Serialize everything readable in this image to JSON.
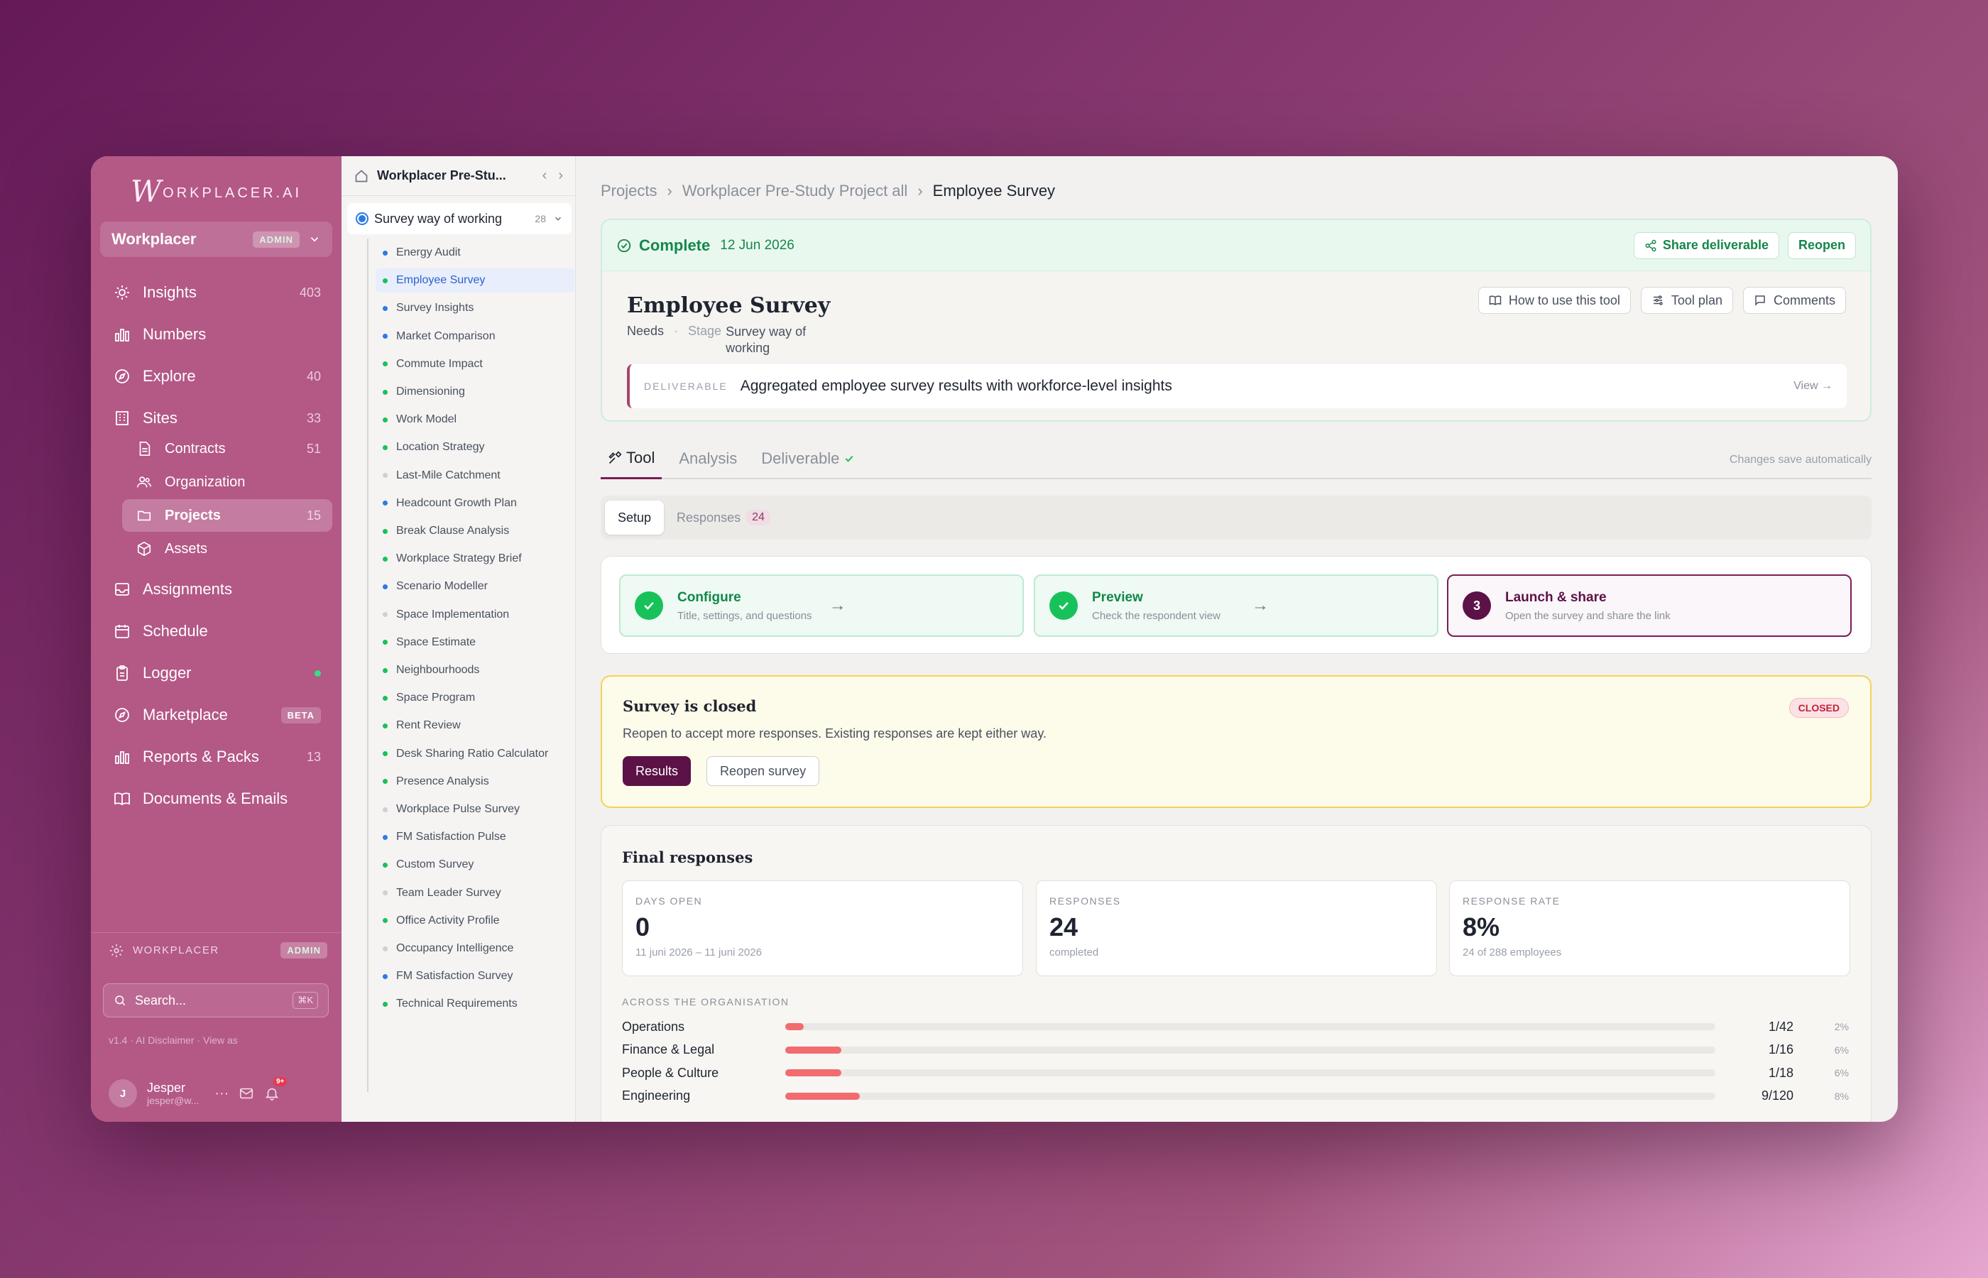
{
  "sidebar": {
    "logo_initial": "W",
    "logo_text": "ORKPLACER.AI",
    "workspace": {
      "name": "Workplacer",
      "badge": "ADMIN"
    },
    "nav": [
      {
        "label": "Insights",
        "count": "403",
        "icon": "lightbulb-icon"
      },
      {
        "label": "Numbers",
        "count": "",
        "icon": "bar-chart-icon"
      },
      {
        "label": "Explore",
        "count": "40",
        "icon": "compass-icon"
      },
      {
        "label": "Sites",
        "count": "33",
        "icon": "building-icon"
      },
      {
        "label": "Contracts",
        "count": "51",
        "icon": "document-icon"
      },
      {
        "label": "Organization",
        "count": "",
        "icon": "users-icon"
      },
      {
        "label": "Projects",
        "count": "15",
        "icon": "folder-icon"
      },
      {
        "label": "Assets",
        "count": "",
        "icon": "cube-icon"
      },
      {
        "label": "Assignments",
        "count": "",
        "icon": "inbox-icon"
      },
      {
        "label": "Schedule",
        "count": "",
        "icon": "calendar-icon"
      },
      {
        "label": "Logger",
        "count": "",
        "icon": "clipboard-icon"
      },
      {
        "label": "Marketplace",
        "badge": "BETA",
        "icon": "compass-icon"
      },
      {
        "label": "Reports & Packs",
        "count": "13",
        "icon": "bar-chart-icon"
      },
      {
        "label": "Documents & Emails",
        "count": "",
        "icon": "book-icon"
      }
    ],
    "footer_workspace": "WORKPLACER",
    "footer_badge": "ADMIN",
    "search_placeholder": "Search...",
    "search_shortcut": "⌘K",
    "version_line": "v1.4 · AI Disclaimer · View as",
    "user": {
      "initial": "J",
      "name": "Jesper",
      "email": "jesper@w...",
      "notif_count": "9+"
    }
  },
  "tree": {
    "project_title": "Workplacer Pre-Stu...",
    "group": {
      "label": "Survey way of working",
      "count": "28"
    },
    "items": [
      {
        "label": "Energy Audit",
        "color": "#2c7be5"
      },
      {
        "label": "Employee Survey",
        "color": "#18c25a"
      },
      {
        "label": "Survey Insights",
        "color": "#2c7be5"
      },
      {
        "label": "Market Comparison",
        "color": "#2c7be5"
      },
      {
        "label": "Commute Impact",
        "color": "#18c25a"
      },
      {
        "label": "Dimensioning",
        "color": "#18c25a"
      },
      {
        "label": "Work Model",
        "color": "#18c25a"
      },
      {
        "label": "Location Strategy",
        "color": "#18c25a"
      },
      {
        "label": "Last-Mile Catchment",
        "color": "#d0d0d0"
      },
      {
        "label": "Headcount Growth Plan",
        "color": "#2c7be5"
      },
      {
        "label": "Break Clause Analysis",
        "color": "#18c25a"
      },
      {
        "label": "Workplace Strategy Brief",
        "color": "#18c25a"
      },
      {
        "label": "Scenario Modeller",
        "color": "#2c7be5"
      },
      {
        "label": "Space Implementation",
        "color": "#d0d0d0"
      },
      {
        "label": "Space Estimate",
        "color": "#18c25a"
      },
      {
        "label": "Neighbourhoods",
        "color": "#18c25a"
      },
      {
        "label": "Space Program",
        "color": "#18c25a"
      },
      {
        "label": "Rent Review",
        "color": "#18c25a"
      },
      {
        "label": "Desk Sharing Ratio Calculator",
        "color": "#18c25a"
      },
      {
        "label": "Presence Analysis",
        "color": "#18c25a"
      },
      {
        "label": "Workplace Pulse Survey",
        "color": "#d0d0d0"
      },
      {
        "label": "FM Satisfaction Pulse",
        "color": "#2c7be5"
      },
      {
        "label": "Custom Survey",
        "color": "#18c25a"
      },
      {
        "label": "Team Leader Survey",
        "color": "#d0d0d0"
      },
      {
        "label": "Office Activity Profile",
        "color": "#18c25a"
      },
      {
        "label": "Occupancy Intelligence",
        "color": "#d0d0d0"
      },
      {
        "label": "FM Satisfaction Survey",
        "color": "#2c7be5"
      },
      {
        "label": "Technical Requirements",
        "color": "#18c25a"
      }
    ],
    "active_index": 1
  },
  "main": {
    "breadcrumb": [
      "Projects",
      "Workplacer Pre-Study Project all",
      "Employee Survey"
    ],
    "status": {
      "label": "Complete",
      "date": "12 Jun 2026"
    },
    "share_label": "Share deliverable",
    "reopen_label": "Reopen",
    "title": "Employee Survey",
    "needs_label": "Needs",
    "stage_key": "Stage",
    "stage_value_1": "Survey way of",
    "stage_value_2": "working",
    "header_buttons": {
      "how": "How to use this tool",
      "plan": "Tool plan",
      "comments": "Comments"
    },
    "deliverable": {
      "key": "DELIVERABLE",
      "value": "Aggregated employee survey results with workforce-level insights",
      "view": "View →"
    },
    "tabs": [
      "Tool",
      "Analysis",
      "Deliverable"
    ],
    "save_info": "Changes save automatically",
    "subtabs": {
      "setup": "Setup",
      "responses": "Responses",
      "responses_count": "24"
    },
    "steps": [
      {
        "title": "Configure",
        "sub": "Title, settings, and questions"
      },
      {
        "title": "Preview",
        "sub": "Check the respondent view"
      },
      {
        "num": "3",
        "title": "Launch & share",
        "sub": "Open the survey and share the link"
      }
    ],
    "closed": {
      "title": "Survey is closed",
      "text": "Reopen to accept more responses. Existing responses are kept either way.",
      "badge": "CLOSED",
      "results_btn": "Results",
      "reopen_btn": "Reopen survey"
    },
    "final": {
      "title": "Final responses",
      "cards": [
        {
          "key": "DAYS OPEN",
          "value": "0",
          "sub": "11 juni 2026 – 11 juni 2026"
        },
        {
          "key": "RESPONSES",
          "value": "24",
          "sub": "completed"
        },
        {
          "key": "RESPONSE RATE",
          "value": "8%",
          "sub": "24 of 288 employees"
        }
      ],
      "across_label": "ACROSS THE ORGANISATION",
      "rows": [
        {
          "label": "Operations",
          "ratio": "1/42",
          "pct": "2%",
          "fill": 0.02
        },
        {
          "label": "Finance & Legal",
          "ratio": "1/16",
          "pct": "6%",
          "fill": 0.06
        },
        {
          "label": "People & Culture",
          "ratio": "1/18",
          "pct": "6%",
          "fill": 0.06
        },
        {
          "label": "Engineering",
          "ratio": "9/120",
          "pct": "8%",
          "fill": 0.08
        }
      ]
    }
  }
}
